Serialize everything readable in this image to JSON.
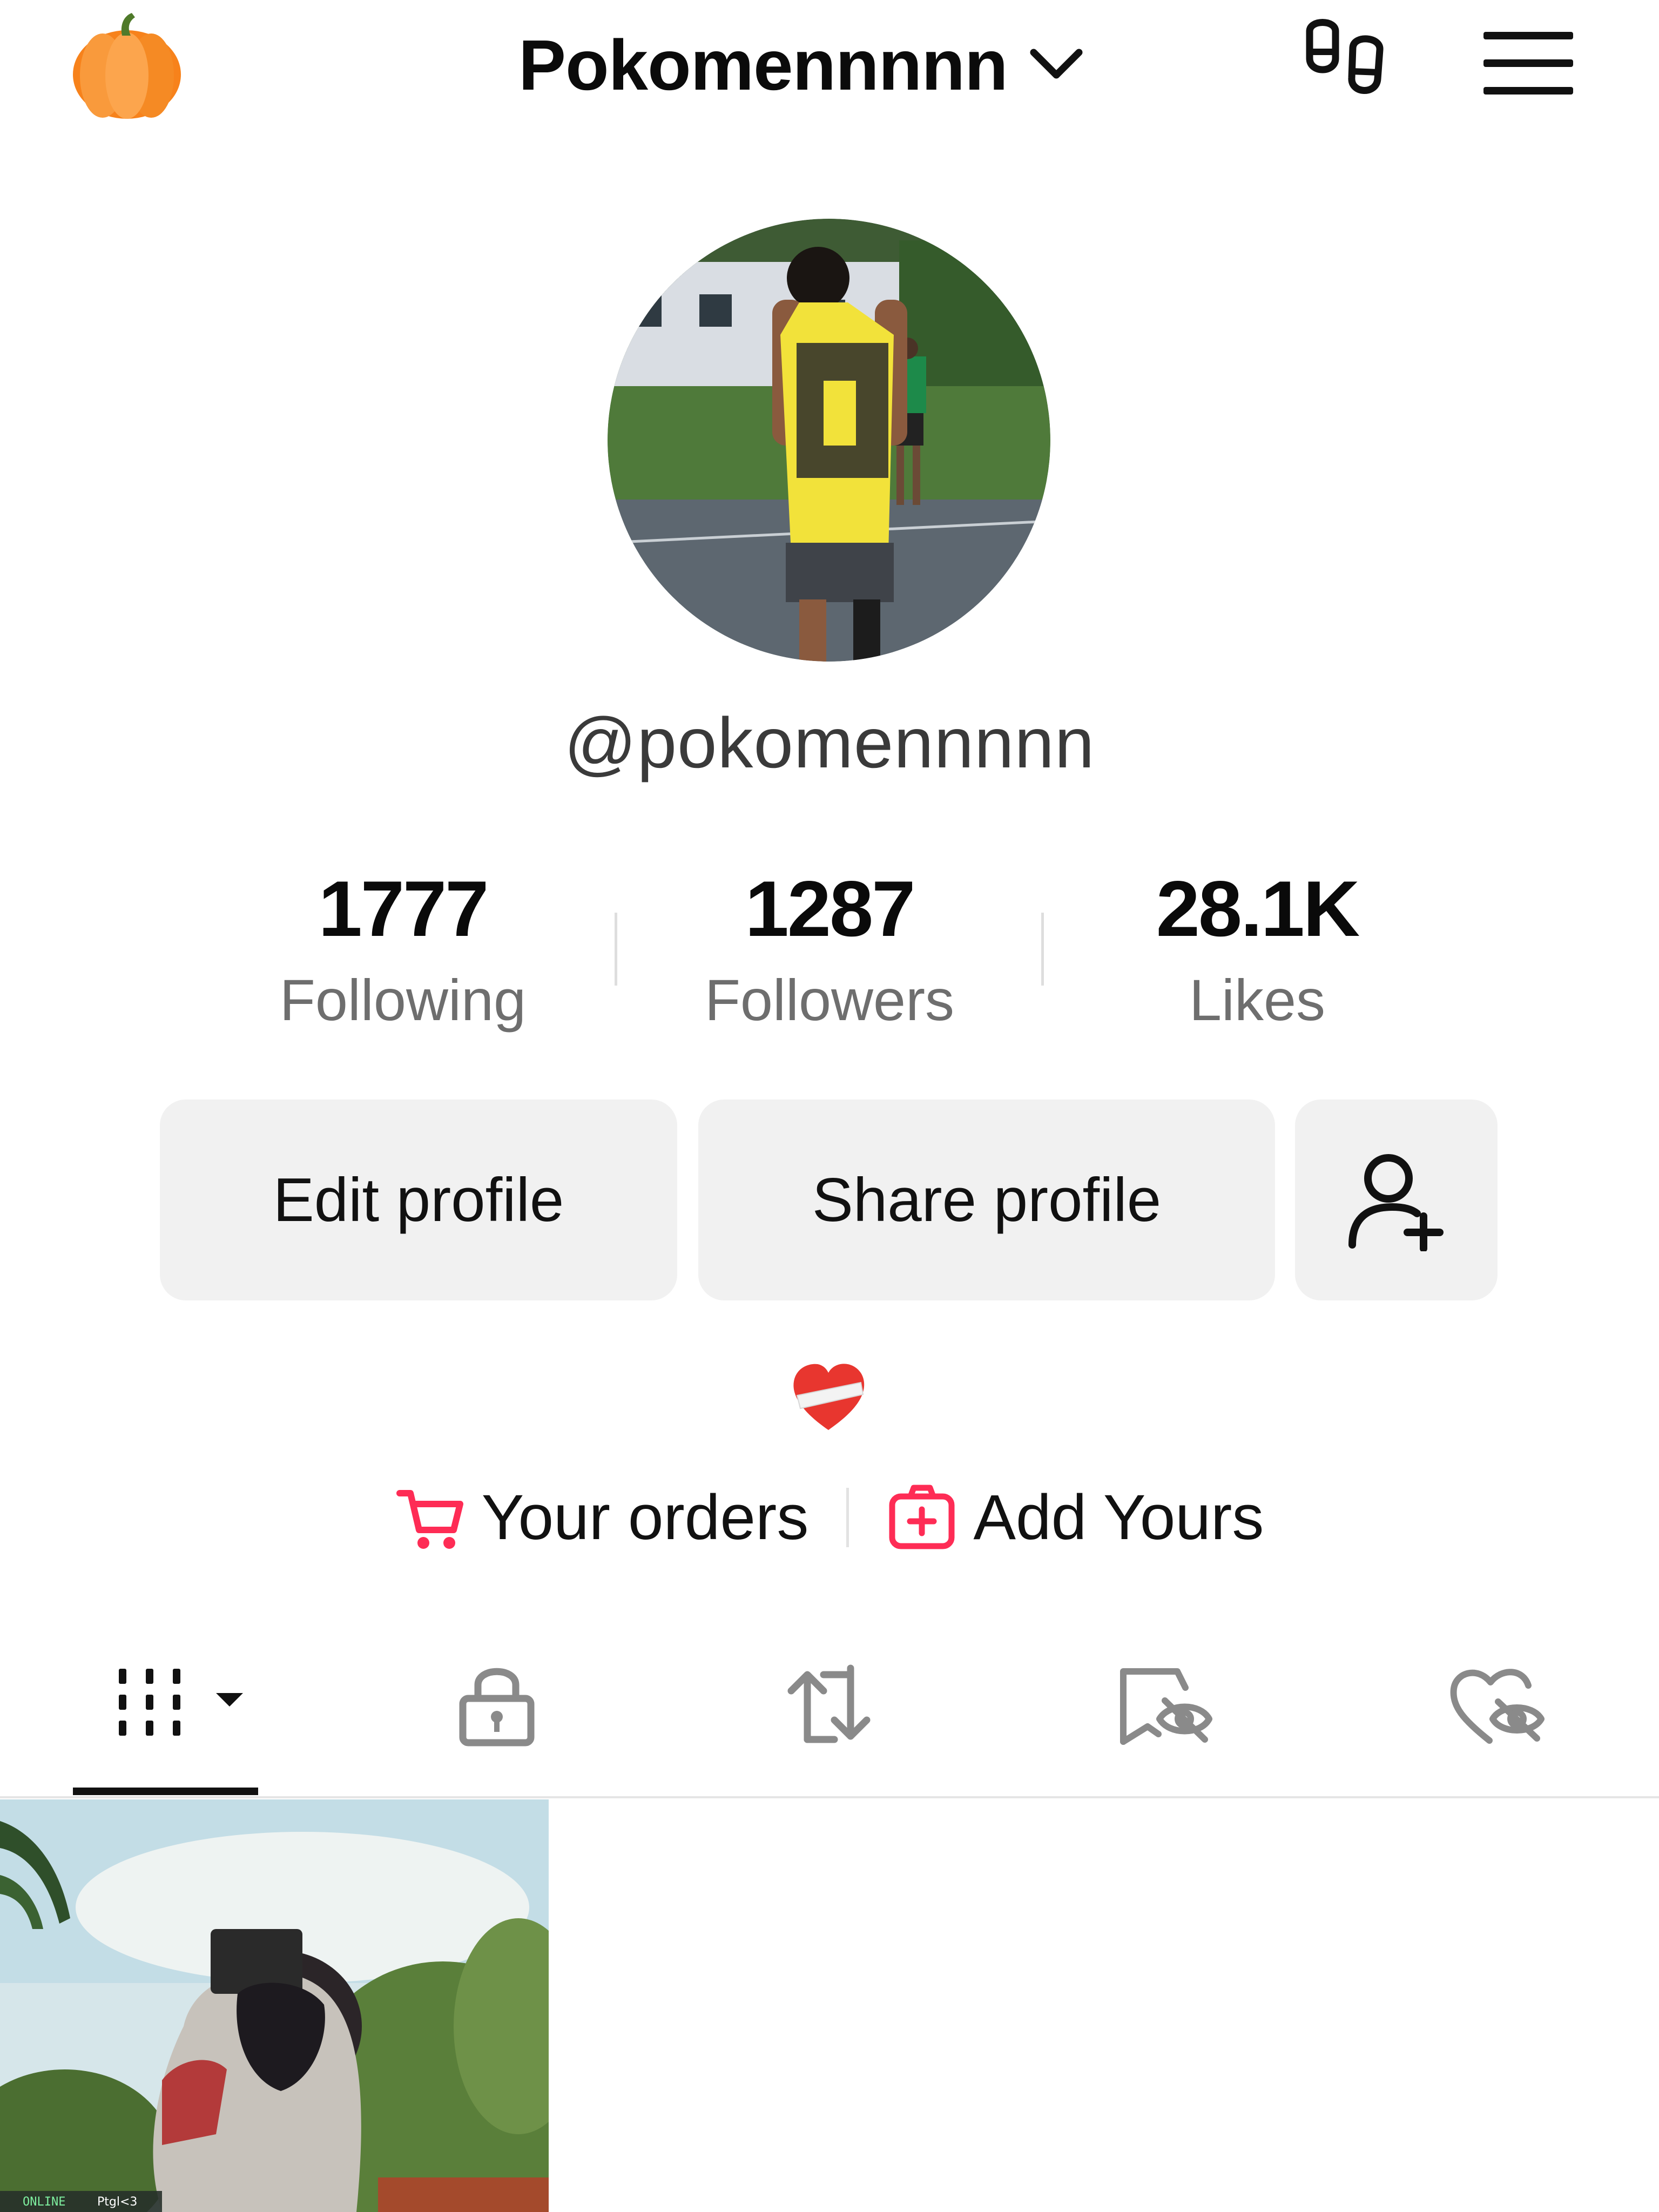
{
  "header": {
    "username_title": "Pokomennnnn",
    "icons": [
      "pumpkin-icon",
      "chevron-down-icon",
      "footprints-icon",
      "menu-icon"
    ]
  },
  "profile": {
    "handle": "@pokomennnnn",
    "bio_emoji": "❤️‍🩹"
  },
  "stats": [
    {
      "value": "1777",
      "label": "Following"
    },
    {
      "value": "1287",
      "label": "Followers"
    },
    {
      "value": "28.1K",
      "label": "Likes"
    }
  ],
  "buttons": {
    "edit": "Edit profile",
    "share": "Share profile"
  },
  "links": {
    "orders": "Your orders",
    "add_yours": "Add Yours"
  },
  "tabs": [
    {
      "name": "videos",
      "icon": "grid-icon",
      "active": true
    },
    {
      "name": "private",
      "icon": "lock-icon",
      "active": false
    },
    {
      "name": "reposts",
      "icon": "repost-icon",
      "active": false
    },
    {
      "name": "favorites",
      "icon": "bookmark-hidden-icon",
      "active": false
    },
    {
      "name": "liked",
      "icon": "heart-hidden-icon",
      "active": false
    }
  ],
  "video_overlay": {
    "status": "ONLINE",
    "name": "Ptgl<3"
  },
  "colors": {
    "accent": "#fe2c55",
    "pumpkin": "#f7821b",
    "text": "#111111",
    "muted": "#6e6e6e",
    "button_bg": "#f1f1f1"
  }
}
